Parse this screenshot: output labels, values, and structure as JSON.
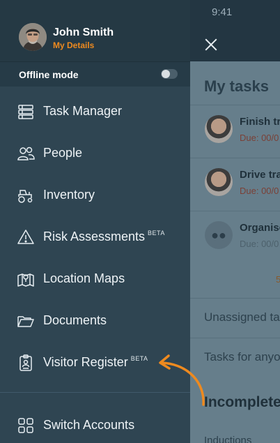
{
  "status_bar": {
    "time": "9:41"
  },
  "profile": {
    "name": "John Smith",
    "details_link": "My Details"
  },
  "offline": {
    "label": "Offline mode",
    "enabled": false
  },
  "menu": {
    "items": [
      {
        "label": "Task Manager",
        "icon": "task-manager-icon"
      },
      {
        "label": "People",
        "icon": "people-icon"
      },
      {
        "label": "Inventory",
        "icon": "tractor-icon"
      },
      {
        "label": "Risk Assessments",
        "icon": "warning-icon",
        "badge": "BETA"
      },
      {
        "label": "Location Maps",
        "icon": "map-icon"
      },
      {
        "label": "Documents",
        "icon": "folder-icon"
      },
      {
        "label": "Visitor Register",
        "icon": "visitor-badge-icon",
        "badge": "BETA"
      },
      {
        "label": "Switch Accounts",
        "icon": "grid-icon"
      }
    ]
  },
  "background_app": {
    "heading": "My tasks",
    "tasks": [
      {
        "title": "Finish tr",
        "due": "Due: 00/0"
      },
      {
        "title": "Drive tra",
        "due": "Due: 00/0"
      },
      {
        "title": "Organise",
        "due": "Due: 00/0"
      }
    ],
    "more": "5",
    "unassigned": "Unassigned ta",
    "tasks_for_anyone": "Tasks for anyo",
    "incomplete": "Incomplete",
    "inductions": "Inductions"
  },
  "colors": {
    "accent": "#ee8a1f",
    "drawer": "#2f4552",
    "header": "#253944"
  }
}
